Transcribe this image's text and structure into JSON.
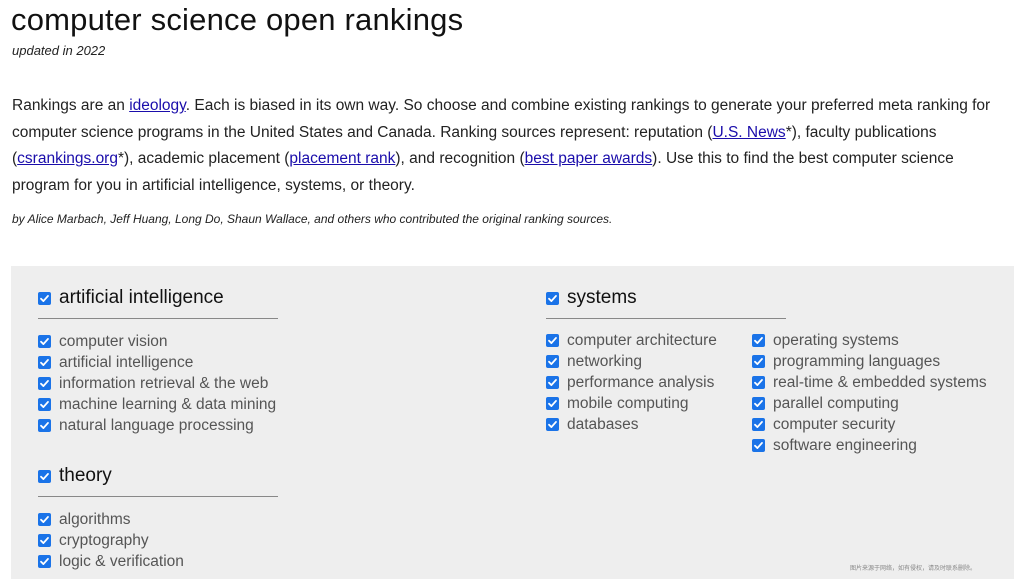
{
  "header": {
    "title": "computer science open rankings",
    "updated": "updated in 2022"
  },
  "intro": {
    "t1": "Rankings are an ",
    "link_ideology": "ideology",
    "t2": ". Each is biased in its own way. So choose and combine existing rankings to generate your preferred meta ranking for computer science programs in the United States and Canada. Ranking sources represent: reputation (",
    "link_usnews": "U.S. News",
    "t3": "*), faculty publications (",
    "link_csrankings": "csrankings.org",
    "t4": "*), academic placement (",
    "link_placement": "placement rank",
    "t5": "), and recognition (",
    "link_bestpaper": "best paper awards",
    "t6": "). Use this to find the best computer science program for you in artificial intelligence, systems, or theory."
  },
  "authors": "by Alice Marbach, Jeff Huang, Long Do, Shaun Wallace, and others who contributed the original ranking sources.",
  "colors": {
    "accent": "#1a73e8",
    "panel_bg": "#eeeeee",
    "link": "#1a0dab"
  },
  "areas": {
    "ai": {
      "label": "artificial intelligence",
      "checked": true,
      "items": [
        "computer vision",
        "artificial intelligence",
        "information retrieval & the web",
        "machine learning & data mining",
        "natural language processing"
      ]
    },
    "theory": {
      "label": "theory",
      "checked": true,
      "items": [
        "algorithms",
        "cryptography",
        "logic & verification"
      ]
    },
    "systems": {
      "label": "systems",
      "checked": true,
      "items_col1": [
        "computer architecture",
        "networking",
        "performance analysis",
        "mobile computing",
        "databases"
      ],
      "items_col2": [
        "operating systems",
        "programming languages",
        "real-time & embedded systems",
        "parallel computing",
        "computer security",
        "software engineering"
      ]
    }
  },
  "watermark": "图片来源于网络，如有侵权，请及时联系删除。"
}
